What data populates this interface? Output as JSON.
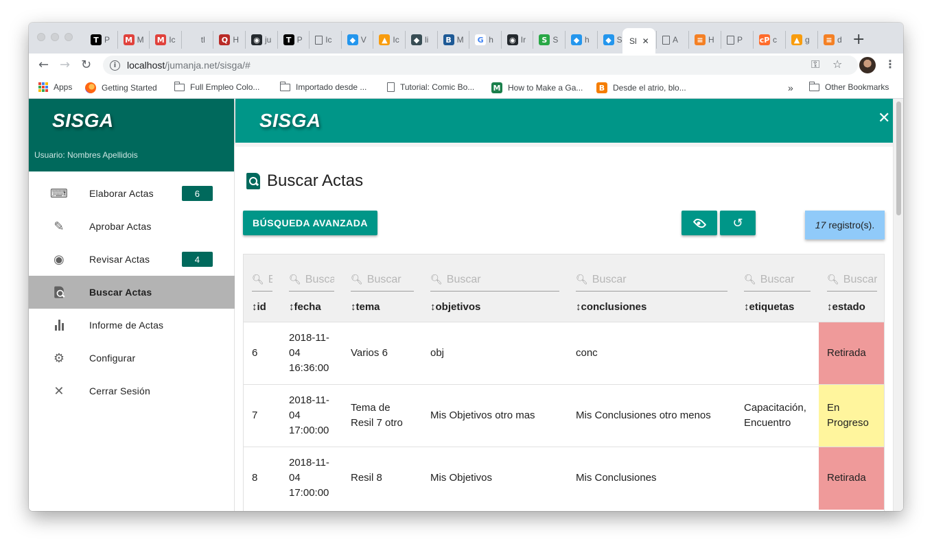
{
  "browser": {
    "tabs": [
      {
        "fav": "T",
        "color": "#000000",
        "text": "P"
      },
      {
        "fav": "M",
        "color": "#e0423c",
        "text": "M"
      },
      {
        "fav": "M",
        "color": "#e0423c",
        "text": "Ic"
      },
      {
        "fav": "",
        "color": "#ffffff",
        "text": "tl"
      },
      {
        "fav": "Q",
        "color": "#b92b27",
        "text": "H"
      },
      {
        "fav": "gh",
        "color": "#24292e",
        "text": "ju"
      },
      {
        "fav": "T",
        "color": "#000000",
        "text": "P"
      },
      {
        "fav": "doc",
        "color": "#5f6368",
        "text": "Ic"
      },
      {
        "fav": "d",
        "color": "#2496ed",
        "text": "V"
      },
      {
        "fav": "PMA",
        "color": "#f89c0e",
        "text": "Ic"
      },
      {
        "fav": "d",
        "color": "#384d54",
        "text": "li"
      },
      {
        "fav": "B",
        "color": "#1e5a96",
        "text": "M"
      },
      {
        "fav": "G",
        "color": "#4285f4",
        "text": "h"
      },
      {
        "fav": "gh",
        "color": "#24292e",
        "text": "Ir"
      },
      {
        "fav": "S",
        "color": "#28a745",
        "text": "S"
      },
      {
        "fav": "d",
        "color": "#2496ed",
        "text": "h"
      },
      {
        "fav": "d",
        "color": "#2496ed",
        "text": "S"
      }
    ],
    "active_tab": {
      "title": "Sl",
      "close": "✕"
    },
    "tabs_after": [
      {
        "fav": "doc",
        "color": "#5f6368",
        "text": "A"
      },
      {
        "fav": "so",
        "color": "#f48024",
        "text": "H"
      },
      {
        "fav": "doc",
        "color": "#5f6368",
        "text": "P"
      },
      {
        "fav": "cP",
        "color": "#ff6c2c",
        "text": "c"
      },
      {
        "fav": "PMA",
        "color": "#f89c0e",
        "text": "g"
      },
      {
        "fav": "so",
        "color": "#f48024",
        "text": "d"
      }
    ],
    "new_tab": "+",
    "url_host": "localhost",
    "url_path": "/jumanja.net/sisga/#",
    "bookmarks": [
      {
        "icon": "apps",
        "label": "Apps"
      },
      {
        "icon": "firefox",
        "label": "Getting Started"
      },
      {
        "icon": "folder",
        "label": "Full Empleo Colo..."
      },
      {
        "icon": "folder",
        "label": "Importado desde ..."
      },
      {
        "icon": "page",
        "label": "Tutorial: Comic Bo..."
      },
      {
        "icon": "m",
        "label": "How to Make a Ga..."
      },
      {
        "icon": "blogger",
        "label": "Desde el atrio, blo..."
      }
    ],
    "more_bookmarks": "»",
    "other_bookmarks": "Other Bookmarks"
  },
  "sidebar": {
    "brand": "SISGA",
    "user": "Usuario: Nombres Apellidois",
    "items": [
      {
        "icon": "keyboard-icon",
        "label": "Elaborar Actas",
        "badge": "6"
      },
      {
        "icon": "edit-icon",
        "label": "Aprobar Actas",
        "badge": ""
      },
      {
        "icon": "eye-icon",
        "label": "Revisar Actas",
        "badge": "4"
      },
      {
        "icon": "search-doc-icon",
        "label": "Buscar Actas",
        "badge": ""
      },
      {
        "icon": "bar-chart-icon",
        "label": "Informe de Actas",
        "badge": ""
      },
      {
        "icon": "gear-icon",
        "label": "Configurar",
        "badge": ""
      },
      {
        "icon": "close-icon",
        "label": "Cerrar Sesión",
        "badge": ""
      }
    ],
    "selected_index": 3
  },
  "header": {
    "brand": "SISGA",
    "close": "✕"
  },
  "page": {
    "title": "Buscar Actas",
    "advanced_search": "BÚSQUEDA AVANZADA",
    "count_number": "17",
    "count_suffix": "registro(s).",
    "filter_placeholder": "Buscar",
    "columns": [
      "↕id",
      "↕fecha",
      "↕tema",
      "↕objetivos",
      "↕conclusiones",
      "↕etiquetas",
      "↕estado"
    ],
    "rows": [
      {
        "id": "6",
        "fecha": "2018-11-04 16:36:00",
        "tema": "Varios 6",
        "objetivos": "obj",
        "conclusiones": "conc",
        "etiquetas": "",
        "estado": "Retirada",
        "estado_color": "#ef9a9a"
      },
      {
        "id": "7",
        "fecha": "2018-11-04 17:00:00",
        "tema": "Tema de Resil 7 otro",
        "objetivos": "Mis Objetivos otro mas",
        "conclusiones": "Mis Conclusiones otro menos",
        "etiquetas": "Capacitación, Encuentro",
        "estado": "En Progreso",
        "estado_color": "#fff59d"
      },
      {
        "id": "8",
        "fecha": "2018-11-04 17:00:00",
        "tema": "Resil 8",
        "objetivos": "Mis Objetivos",
        "conclusiones": "Mis Conclusiones",
        "etiquetas": "",
        "estado": "Retirada",
        "estado_color": "#ef9a9a"
      }
    ]
  },
  "colors": {
    "brand_dark": "#00695c",
    "brand": "#009688",
    "count_bg": "#90caf9"
  }
}
